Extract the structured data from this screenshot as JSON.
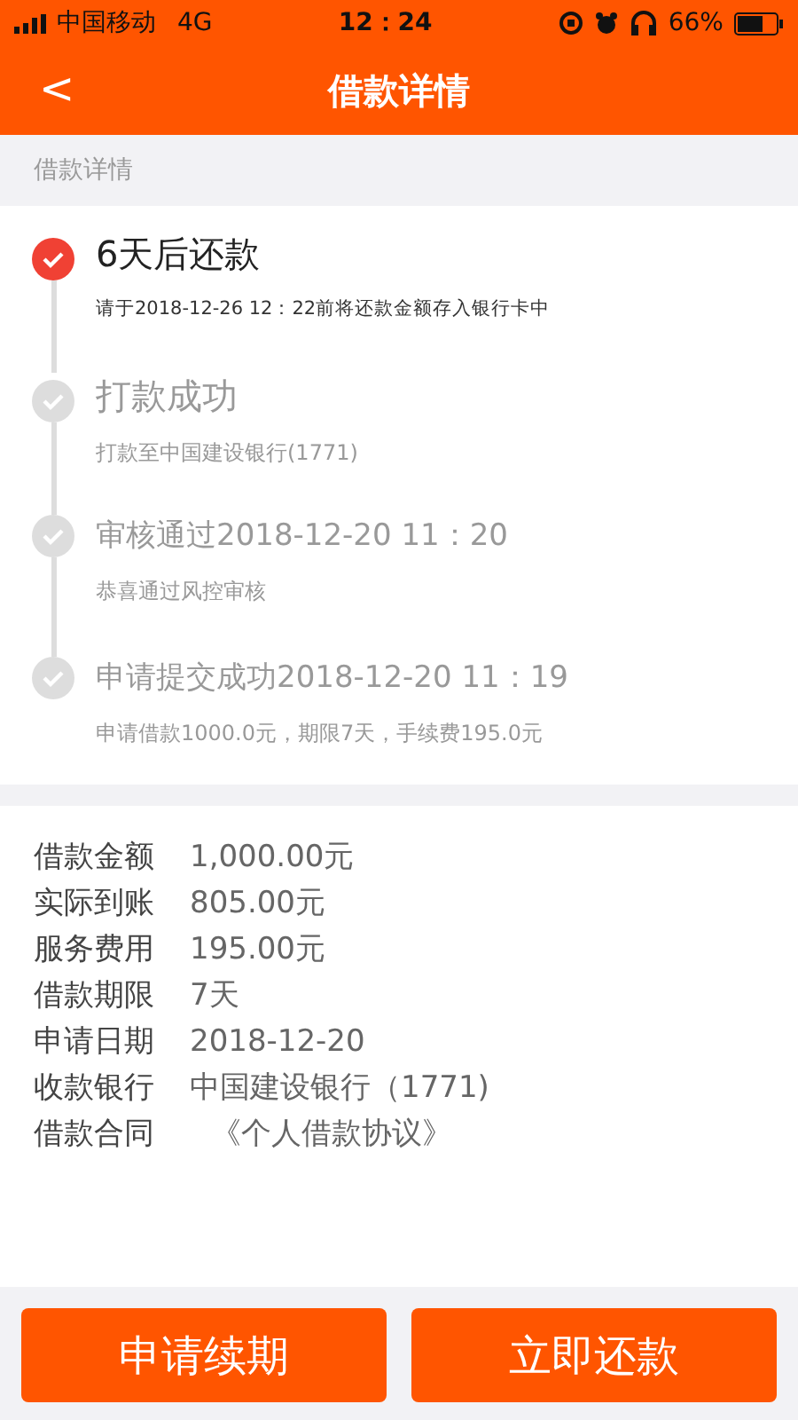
{
  "status_bar": {
    "carrier": "中国移动",
    "network": "4G",
    "time": "12：24",
    "battery": "66%"
  },
  "header": {
    "back": "<",
    "title": "借款详情"
  },
  "section_title": "借款详情",
  "timeline": [
    {
      "title": "6天后还款",
      "detail": "请于2018-12-26 12：22前将还款金额存入银行卡中",
      "active": true
    },
    {
      "title": "打款成功",
      "detail": "打款至中国建设银行(1771)",
      "active": false
    },
    {
      "title": "审核通过2018-12-20 11：20",
      "detail": "恭喜通过风控审核",
      "active": false
    },
    {
      "title": "申请提交成功2018-12-20 11：19",
      "detail": "申请借款1000.0元，期限7天，手续费195.0元",
      "active": false
    }
  ],
  "details": [
    {
      "label": "借款金额",
      "value": "1,000.00元"
    },
    {
      "label": "实际到账",
      "value": "805.00元"
    },
    {
      "label": "服务费用",
      "value": "195.00元"
    },
    {
      "label": "借款期限",
      "value": "7天"
    },
    {
      "label": "申请日期",
      "value": "2018-12-20"
    },
    {
      "label": "收款银行",
      "value": "中国建设银行（1771)"
    },
    {
      "label": "借款合同",
      "value": "《个人借款协议》",
      "kind": "link"
    }
  ],
  "buttons": [
    "申请续期",
    "立即还款"
  ]
}
